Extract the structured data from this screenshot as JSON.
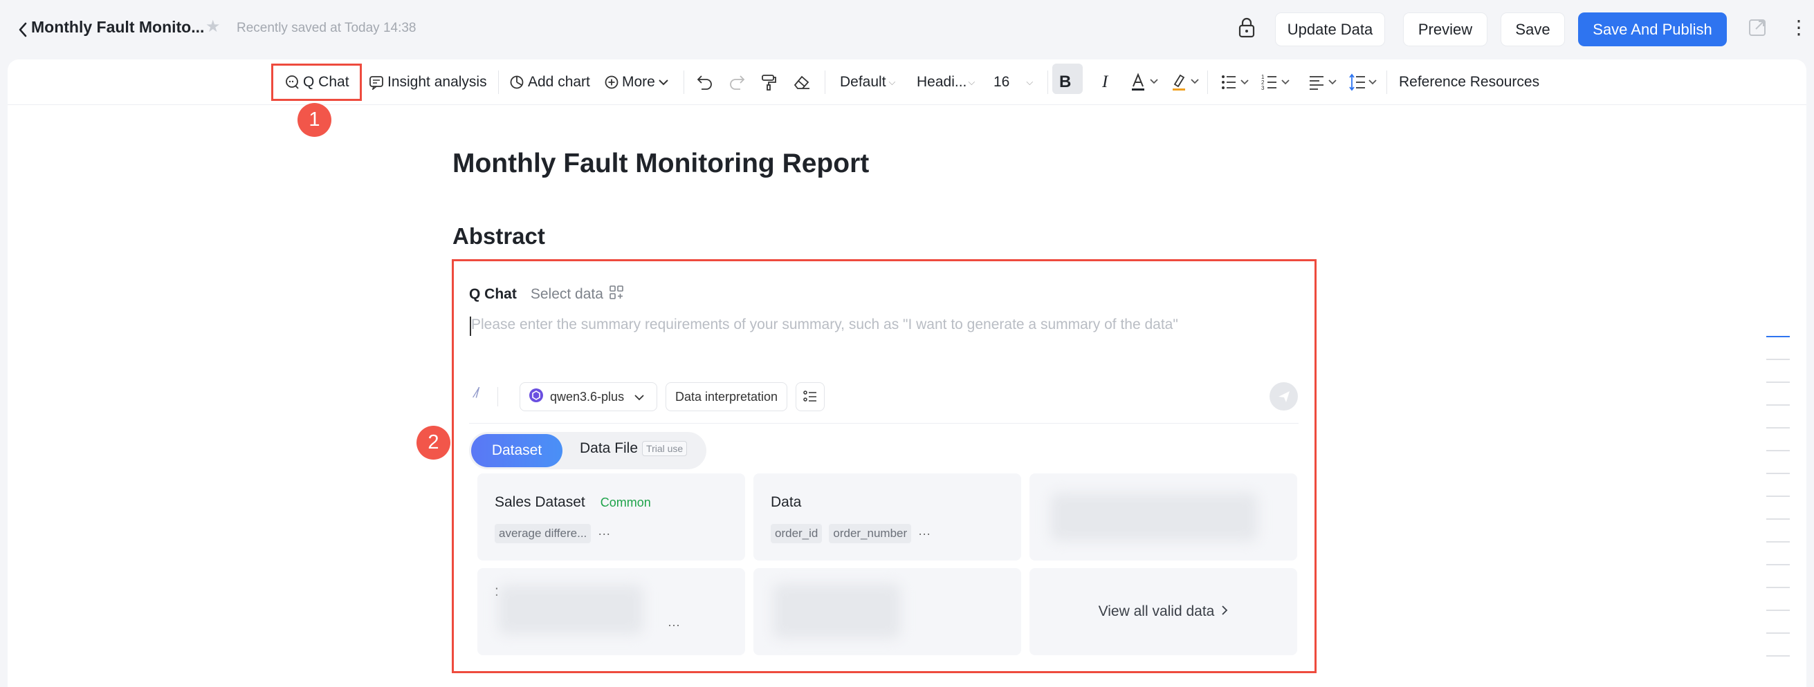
{
  "header": {
    "doc_title": "Monthly Fault Monito...",
    "saved_status": "Recently saved at Today 14:38",
    "buttons": {
      "update_data": "Update Data",
      "preview": "Preview",
      "save": "Save",
      "save_publish": "Save And Publish"
    }
  },
  "toolbar": {
    "q_chat": "Q Chat",
    "insight": "Insight analysis",
    "add_chart": "Add chart",
    "more": "More",
    "font_family": "Default",
    "heading": "Headi...",
    "font_size": "16",
    "reference": "Reference Resources"
  },
  "annotations": {
    "step1": "1",
    "step2": "2"
  },
  "document": {
    "title": "Monthly Fault Monitoring Report",
    "section": "Abstract"
  },
  "qchat": {
    "label": "Q Chat",
    "select_data": "Select data",
    "placeholder": "Please enter the summary requirements of your summary, such as \"I want to generate a summary of the data\"",
    "model": "qwen3.6-plus",
    "mode": "Data interpretation",
    "tabs": {
      "dataset": "Dataset",
      "data_file": "Data File",
      "trial": "Trial use"
    },
    "cards": [
      {
        "name": "Sales Dataset",
        "tag": "Common",
        "chips": [
          "average differe..."
        ],
        "more": "···"
      },
      {
        "name": "Data",
        "chips": [
          "order_id",
          "order_number"
        ],
        "more": "···"
      }
    ],
    "view_all": "View all valid data",
    "card_more": "···",
    "colon_mark": ":"
  },
  "colors": {
    "accent": "#2e74f0",
    "highlight": "#ee4b3e",
    "common_tag": "#1ea34a"
  }
}
